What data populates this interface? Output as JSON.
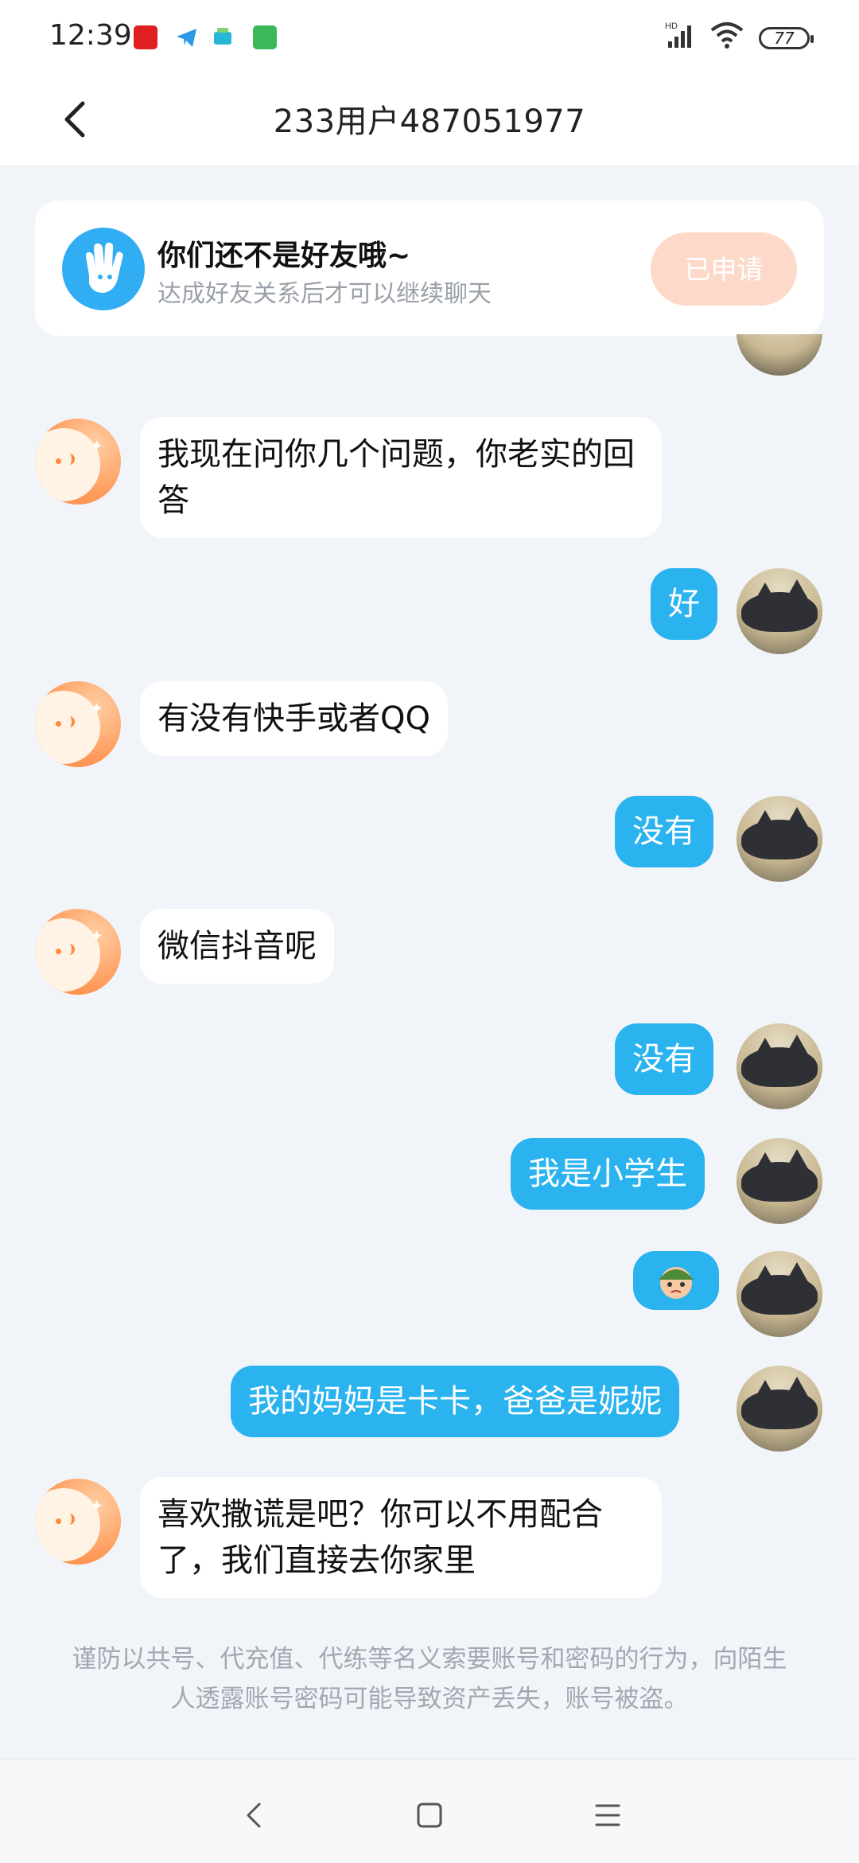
{
  "status": {
    "time": "12:39",
    "battery": "77",
    "network": "HD"
  },
  "header": {
    "title": "233用户487051977"
  },
  "banner": {
    "title": "你们还不是好友哦~",
    "subtitle": "达成好友关系后才可以继续聊天",
    "button": "已申请"
  },
  "messages": [
    {
      "side": "left",
      "text": "我现在问你几个问题，你老实的回答"
    },
    {
      "side": "right",
      "text": "好"
    },
    {
      "side": "left",
      "text": "有没有快手或者QQ"
    },
    {
      "side": "right",
      "text": "没有"
    },
    {
      "side": "left",
      "text": "微信抖音呢"
    },
    {
      "side": "right",
      "text": "没有"
    },
    {
      "side": "right",
      "text": "我是小学生"
    },
    {
      "side": "right",
      "sticker": "soldier-emoji"
    },
    {
      "side": "right",
      "text": "我的妈妈是卡卡，爸爸是妮妮"
    },
    {
      "side": "left",
      "text": "喜欢撒谎是吧？你可以不用配合了，我们直接去你家里"
    }
  ],
  "notice": "谨防以共号、代充值、代练等名义索要账号和密码的行为，向陌生人透露账号密码可能导致资产丢失，账号被盗。",
  "colors": {
    "sent_bubble": "#2ab3ef",
    "received_bubble": "#ffffff",
    "applied_button": "#fcd9c9",
    "background": "#f1f4f9"
  }
}
